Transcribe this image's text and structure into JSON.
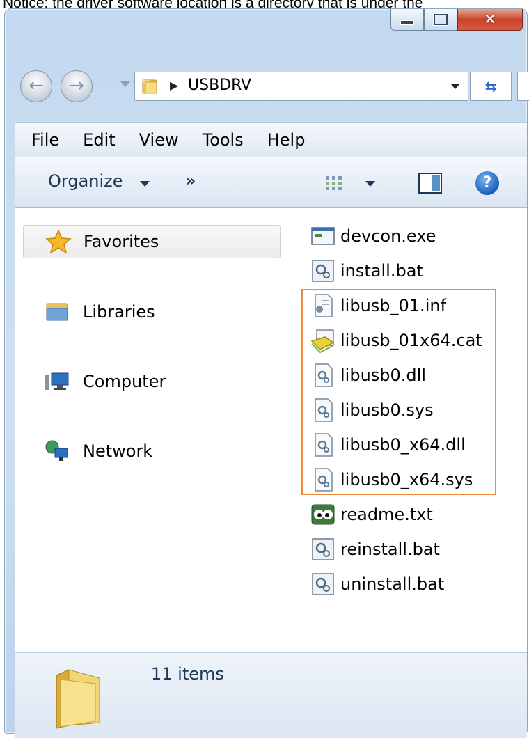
{
  "notice": "Notice: the driver software location is a directory that is under the",
  "window": {
    "caption_buttons": [
      "minimize-icon",
      "maximize-icon",
      "close-icon"
    ]
  },
  "navigation": {
    "back_icon": "back-arrow-icon",
    "forward_icon": "forward-arrow-icon",
    "address_path": "USBDRV"
  },
  "menu": {
    "file": "File",
    "edit": "Edit",
    "view": "View",
    "tools": "Tools",
    "help": "Help"
  },
  "toolbar": {
    "organize": "Organize",
    "more": "»"
  },
  "sidebar": {
    "items": [
      {
        "label": "Favorites",
        "icon": "star-icon",
        "selected": true
      },
      {
        "label": "Libraries",
        "icon": "libraries-icon"
      },
      {
        "label": "Computer",
        "icon": "computer-icon"
      },
      {
        "label": "Network",
        "icon": "network-icon"
      }
    ]
  },
  "files": [
    {
      "name": "devcon.exe",
      "icon": "exe-icon"
    },
    {
      "name": "install.bat",
      "icon": "bat-icon"
    },
    {
      "name": "libusb_01.inf",
      "icon": "inf-icon"
    },
    {
      "name": "libusb_01x64.cat",
      "icon": "cat-icon"
    },
    {
      "name": "libusb0.dll",
      "icon": "dll-icon"
    },
    {
      "name": "libusb0.sys",
      "icon": "sys-icon"
    },
    {
      "name": "libusb0_x64.dll",
      "icon": "dll-icon"
    },
    {
      "name": "libusb0_x64.sys",
      "icon": "sys-icon"
    },
    {
      "name": "readme.txt",
      "icon": "txt-icon"
    },
    {
      "name": "reinstall.bat",
      "icon": "bat-icon"
    },
    {
      "name": "uninstall.bat",
      "icon": "bat-icon"
    }
  ],
  "highlight": {
    "color": "#f08a3c",
    "files": [
      "libusb_01.inf",
      "libusb_01x64.cat",
      "libusb0.dll",
      "libusb0.sys",
      "libusb0_x64.dll",
      "libusb0_x64.sys"
    ]
  },
  "status": {
    "item_count": "11 items"
  }
}
